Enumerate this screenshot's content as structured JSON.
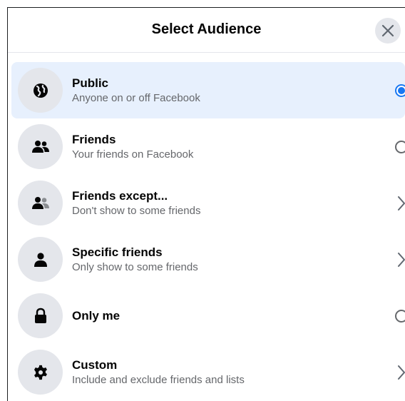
{
  "dialog": {
    "title": "Select Audience",
    "close_icon": "close-icon"
  },
  "options": [
    {
      "label": "Public",
      "sub": "Anyone on or off Facebook",
      "icon": "globe-icon",
      "control": "radio",
      "selected": true
    },
    {
      "label": "Friends",
      "sub": "Your friends on Facebook",
      "icon": "friends-icon",
      "control": "radio",
      "selected": false
    },
    {
      "label": "Friends except...",
      "sub": "Don't show to some friends",
      "icon": "friends-except-icon",
      "control": "chevron",
      "selected": false
    },
    {
      "label": "Specific friends",
      "sub": "Only show to some friends",
      "icon": "person-icon",
      "control": "chevron",
      "selected": false
    },
    {
      "label": "Only me",
      "sub": "",
      "icon": "lock-icon",
      "control": "radio",
      "selected": false
    },
    {
      "label": "Custom",
      "sub": "Include and exclude friends and lists",
      "icon": "gear-icon",
      "control": "chevron",
      "selected": false
    }
  ],
  "colors": {
    "accent": "#1877f2",
    "selected_bg": "#e7f0fd",
    "icon_bg": "#e4e6eb",
    "secondary_text": "#65676b"
  }
}
